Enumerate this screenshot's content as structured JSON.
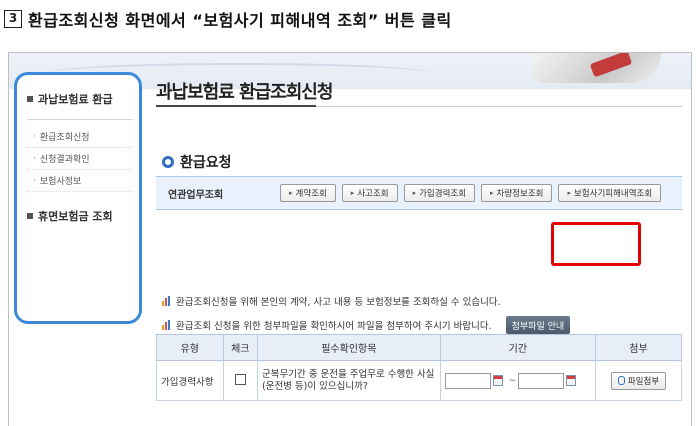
{
  "instruction": {
    "step_number": "3",
    "text": "환급조회신청 화면에서 “보험사기 피해내역 조회” 버튼 클릭"
  },
  "sidebar": {
    "section1": "과납보험료 환급",
    "items": [
      {
        "label": "환급조회신청"
      },
      {
        "label": "신청결과확인"
      },
      {
        "label": "보험사정보"
      }
    ],
    "section2": "휴면보험금 조회"
  },
  "page": {
    "title": "과납보험료 환급조회신청",
    "section_title": "환급요청"
  },
  "related": {
    "label": "연관업무조회",
    "buttons": [
      "계약조회",
      "사고조회",
      "가입경력조회",
      "차량정보조회",
      "보험사기피해내역조회"
    ]
  },
  "info": {
    "line1": "환급조회신청을 위해 본인의 계약, 사고 내용 등 보험정보를 조회하실 수 있습니다.",
    "line2": "환급조회 신청을 위한 첨부파일을 확인하시어 파일을 첨부하여 주시기 바랍니다.",
    "attach_guide_button": "첨부파일 안내"
  },
  "table": {
    "headers": [
      "유형",
      "체크",
      "필수확인항목",
      "기간",
      "첨부"
    ],
    "rows": [
      {
        "type": "가입경력사항",
        "item": "군복무기간 중 운전을 주업무로 수행한 사실(운전병 등)이 있으십니까?",
        "period_separator": "~",
        "attach_label": "파일첨부"
      }
    ]
  },
  "colors": {
    "sidebar_border": "#3c89d9",
    "highlight": "#e30000",
    "related_bar_bg": "#e9f2fc",
    "table_header_bg": "#e7eef8"
  }
}
